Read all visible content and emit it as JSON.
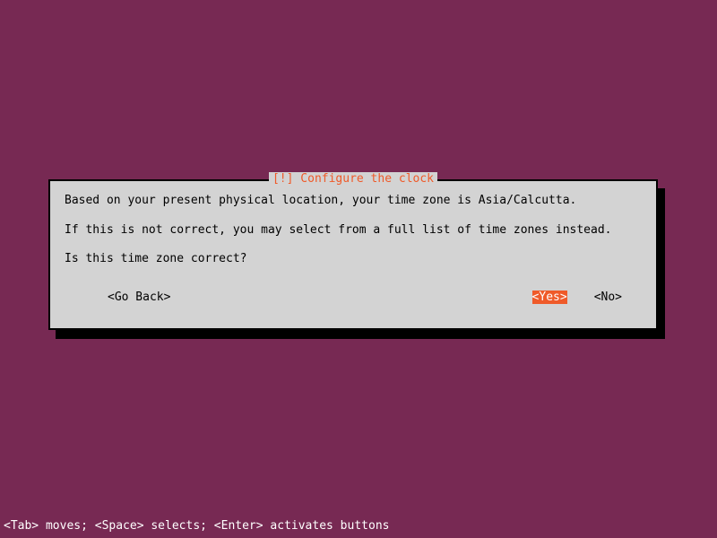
{
  "dialog": {
    "title": "[!] Configure the clock",
    "line1": "Based on your present physical location, your time zone is Asia/Calcutta.",
    "line2": "If this is not correct, you may select from a full list of time zones instead.",
    "line3": "Is this time zone correct?",
    "buttons": {
      "go_back": "<Go Back>",
      "yes": "<Yes>",
      "no": "<No>"
    }
  },
  "status_bar": "<Tab> moves; <Space> selects; <Enter> activates buttons"
}
